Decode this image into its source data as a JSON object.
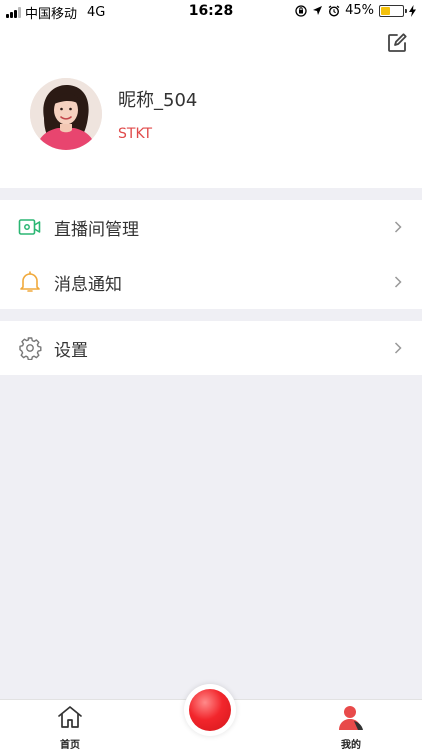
{
  "status_bar": {
    "carrier": "中国移动",
    "network": "4G",
    "time": "16:28",
    "battery": "45%",
    "battery_level": 0.45
  },
  "profile": {
    "nickname": "昵称_504",
    "subtitle": "STKT"
  },
  "menu": {
    "live_room": "直播间管理",
    "notifications": "消息通知",
    "settings": "设置"
  },
  "tabbar": {
    "home": "首页",
    "mine": "我的"
  },
  "colors": {
    "accent": "#e04a4a",
    "live_icon": "#2bb673",
    "bell_icon": "#f0a93b",
    "record": "#f2262c"
  }
}
